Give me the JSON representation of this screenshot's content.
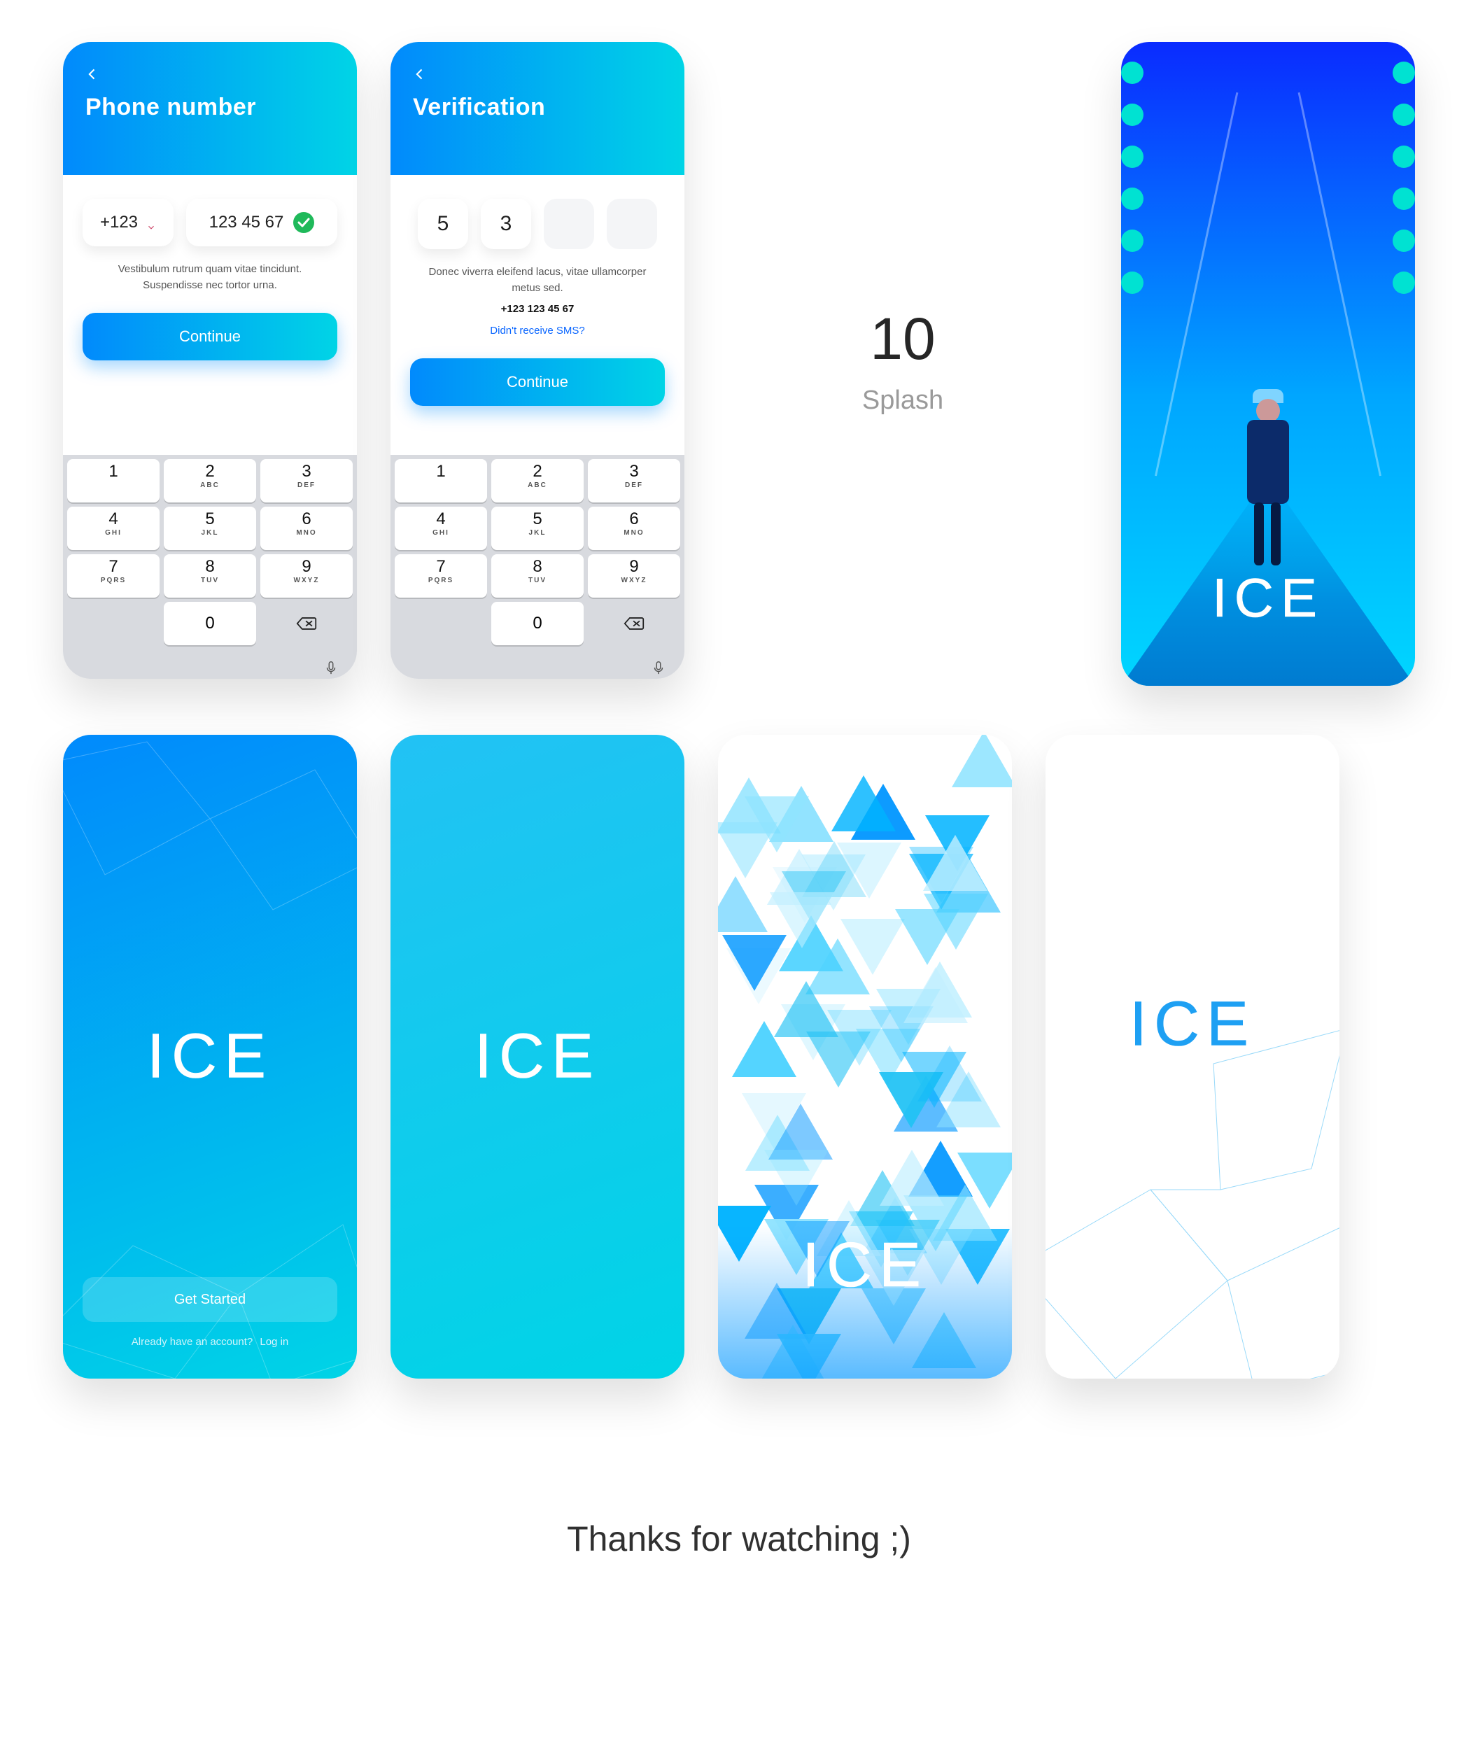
{
  "section": {
    "number": "10",
    "name": "Splash"
  },
  "footer": {
    "thanks": "Thanks for watching ;)"
  },
  "logo": "ICE",
  "screens": {
    "phone": {
      "title": "Phone number",
      "country_code": "+123",
      "number": "123 45 67",
      "help": "Vestibulum rutrum quam vitae tincidunt. Suspendisse nec tortor urna.",
      "cta": "Continue"
    },
    "verify": {
      "title": "Verification",
      "otp": [
        "5",
        "3",
        "",
        ""
      ],
      "help1": "Donec viverra eleifend lacus, vitae ullamcorper metus sed.",
      "phone": "+123 123 45 67",
      "resend": "Didn't receive SMS?",
      "cta": "Continue"
    },
    "splash1": {
      "cta": "Get Started",
      "already": "Already have an account?",
      "login": "Log in"
    }
  },
  "keypad": {
    "keys": [
      {
        "n": "1",
        "s": ""
      },
      {
        "n": "2",
        "s": "ABC"
      },
      {
        "n": "3",
        "s": "DEF"
      },
      {
        "n": "4",
        "s": "GHI"
      },
      {
        "n": "5",
        "s": "JKL"
      },
      {
        "n": "6",
        "s": "MNO"
      },
      {
        "n": "7",
        "s": "PQRS"
      },
      {
        "n": "8",
        "s": "TUV"
      },
      {
        "n": "9",
        "s": "WXYZ"
      }
    ],
    "zero": "0"
  }
}
